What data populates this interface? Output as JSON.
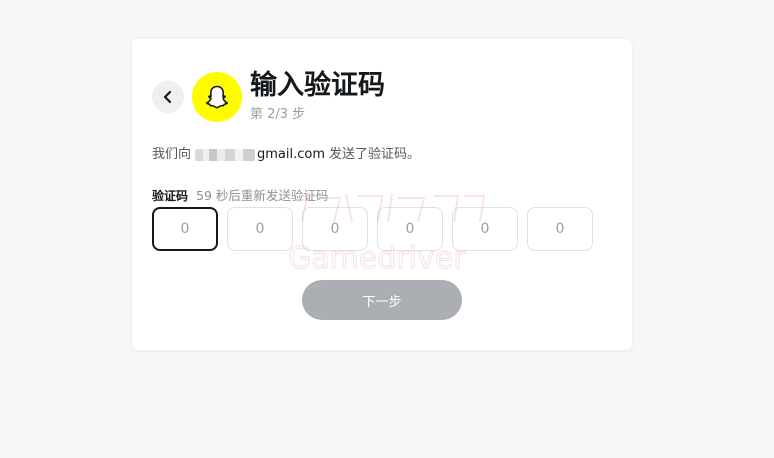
{
  "header": {
    "title": "输入验证码",
    "step": "第 2/3 步"
  },
  "message": {
    "prefix": "我们向",
    "email_visible_suffix": "gmail.com",
    "suffix": "发送了验证码。"
  },
  "code": {
    "label": "验证码",
    "resend_text": "59 秒后重新发送验证码",
    "placeholders": [
      "0",
      "0",
      "0",
      "0",
      "0",
      "0"
    ]
  },
  "buttons": {
    "next_label": "下一步"
  },
  "watermark": {
    "text": "Gamedriver"
  },
  "icons": {
    "back": "chevron-left-icon",
    "logo": "snapchat-ghost-icon"
  },
  "colors": {
    "brand_yellow": "#fffc00",
    "text_dark": "#16191c",
    "button_disabled": "#abaeb2",
    "page_bg": "#f7f7f7"
  }
}
